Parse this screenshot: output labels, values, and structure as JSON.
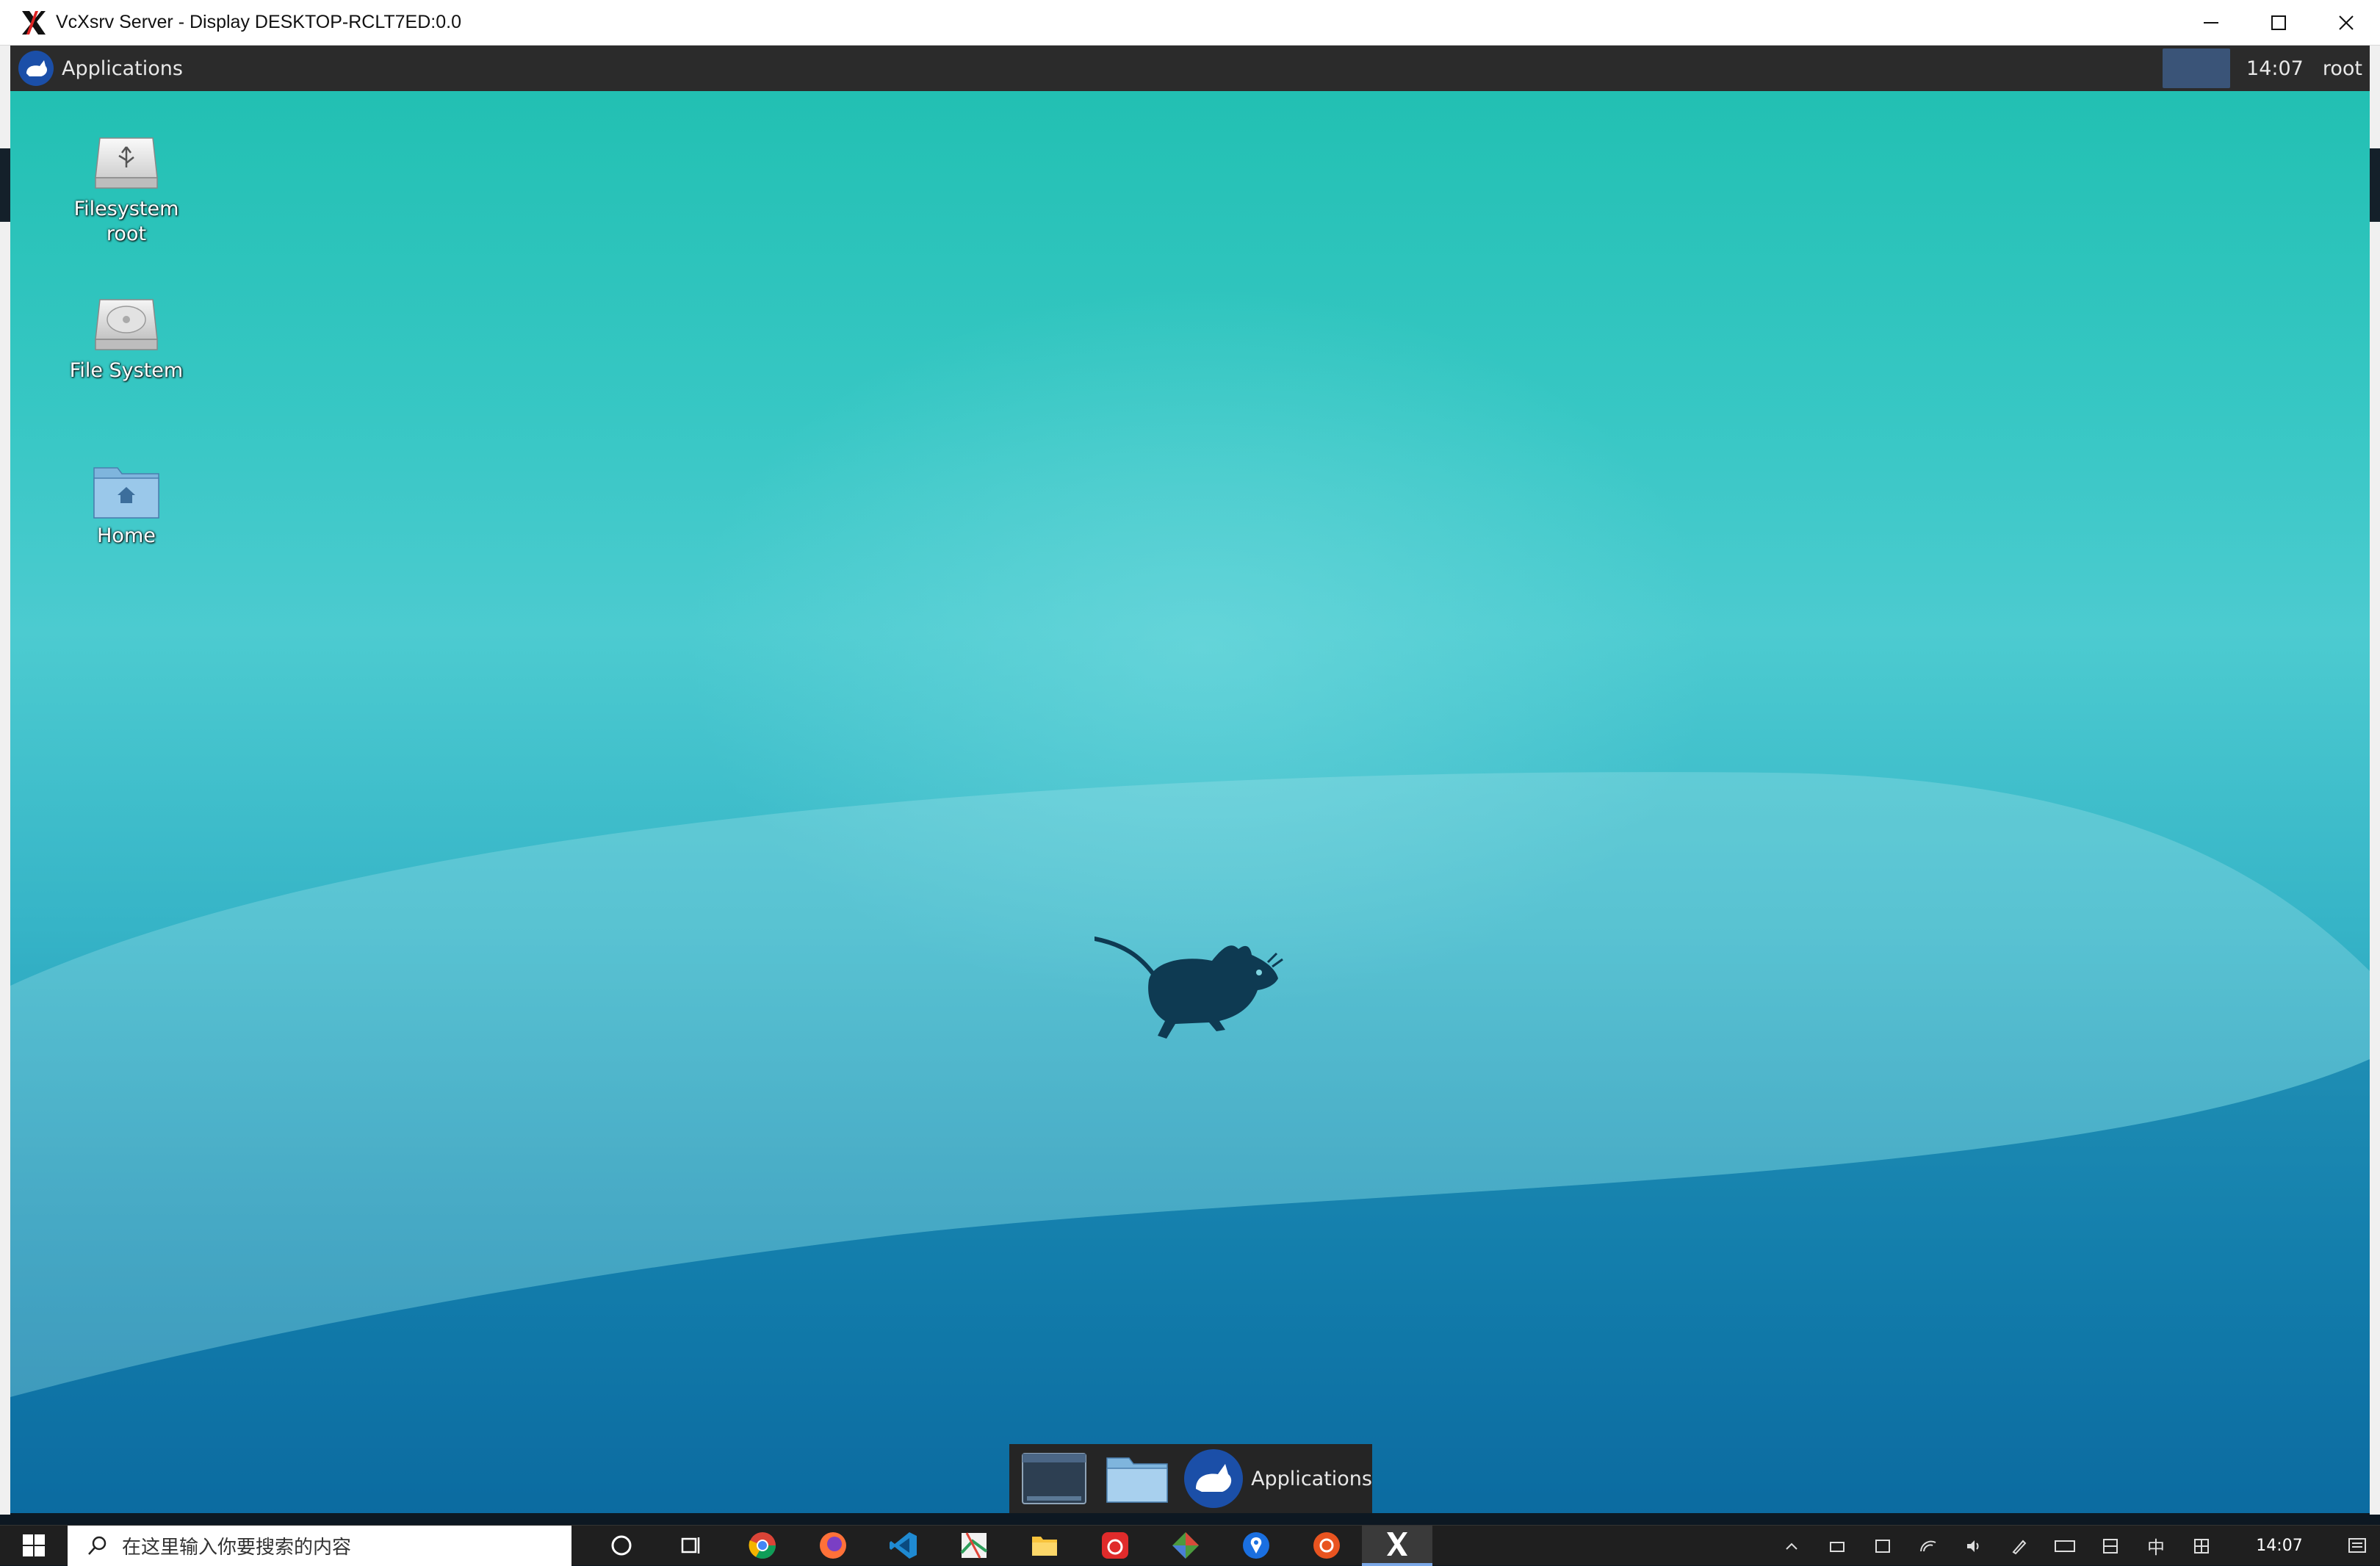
{
  "window": {
    "title": "VcXsrv Server - Display DESKTOP-RCLT7ED:0.0",
    "icon": "x-logo-icon",
    "controls": [
      "minimize-icon",
      "maximize-icon",
      "close-icon"
    ]
  },
  "panel": {
    "menu_label": "Applications",
    "clock": "14:07",
    "user": "root"
  },
  "desktop_icons": [
    {
      "label": "Filesystem root",
      "icon": "usb-drive-icon"
    },
    {
      "label": "File System",
      "icon": "hard-drive-icon"
    },
    {
      "label": "Home",
      "icon": "home-folder-icon"
    }
  ],
  "dock": {
    "apps_label": "Applications",
    "items": [
      "terminal-icon",
      "file-manager-icon",
      "xfce-apps-icon"
    ]
  },
  "taskbar": {
    "search_placeholder": "在这里输入你要搜索的内容",
    "tray_ime": "中",
    "clock_time": "14:07",
    "accent": "#7aa7e6"
  }
}
